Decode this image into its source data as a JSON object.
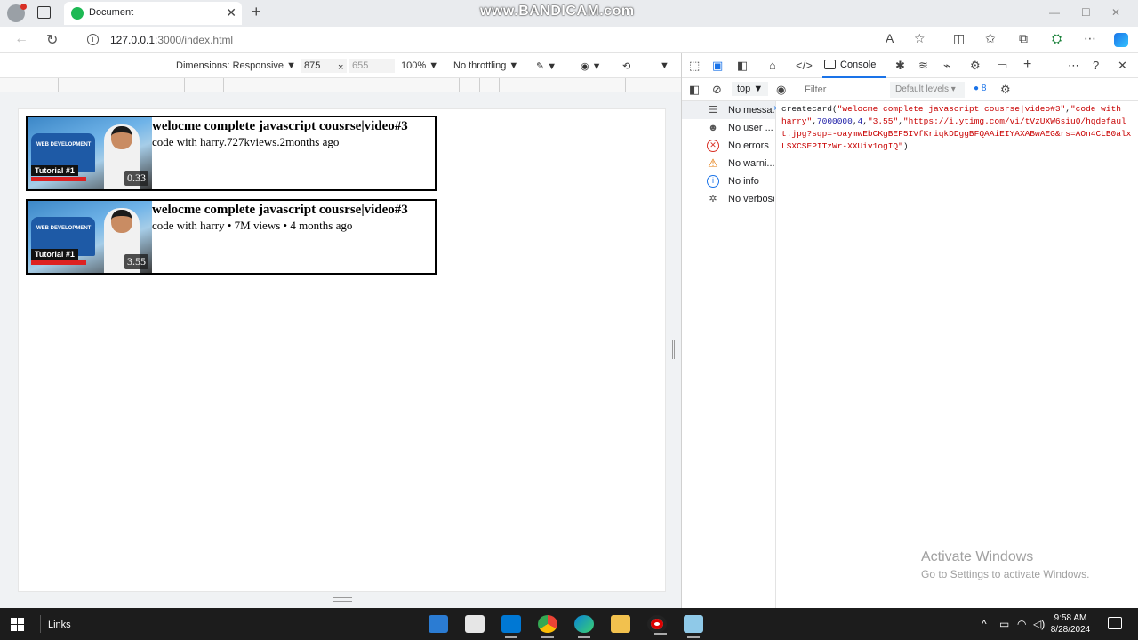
{
  "watermark": "www.BANDICAM.com",
  "browser": {
    "tab_title": "Document",
    "tab_close": "✕",
    "new_tab": "+",
    "url_host": "127.0.0.1",
    "url_rest": ":3000/index.html"
  },
  "device_toolbar": {
    "dimensions": "Dimensions: Responsive",
    "width": "875",
    "times": "×",
    "height": "655",
    "zoom": "100%",
    "throttling": "No throttling"
  },
  "cards": [
    {
      "title": "welocme complete javascript cousrse|video#3",
      "meta": "code with harry.727kviews.2months ago",
      "duration": "0.33",
      "thumb_badge": "Tutorial #1",
      "thumb_text": "WEB DEVELOPMENT"
    },
    {
      "title": "welocme complete javascript cousrse|video#3",
      "meta": "code with harry • 7M views • 4 months ago",
      "duration": "3.55",
      "thumb_badge": "Tutorial #1",
      "thumb_text": "WEB DEVELOPMENT"
    }
  ],
  "devtools": {
    "console_tab": "Console",
    "context": "top",
    "filter_placeholder": "Filter",
    "levels": "Default levels",
    "issues_count": "8",
    "sidebar": [
      {
        "label": "No messa...",
        "icon": "list-icon"
      },
      {
        "label": "No user ...",
        "icon": "user-icon"
      },
      {
        "label": "No errors",
        "icon": "error-icon"
      },
      {
        "label": "No warni...",
        "icon": "warning-icon"
      },
      {
        "label": "No info",
        "icon": "info-icon"
      },
      {
        "label": "No verbose",
        "icon": "verbose-icon"
      }
    ],
    "console": {
      "fn": "createcard(",
      "arg1": "\"welocme complete javascript cousrse|video#3\"",
      "arg2": "\"code with harry\"",
      "arg3": "7000000",
      "arg4": "4",
      "arg5": "\"3.55\"",
      "arg6": "\"https://i.ytimg.com/vi/tVzUXW6siu0/hqdefault.jpg?sqp=-oaymwEbCKgBEF5IVfKriqkDDggBFQAAiEIYAXABwAEG&rs=AOn4CLB0alxLSXCSEPITzWr-XXUiv1ogIQ\"",
      "close": ")"
    }
  },
  "activate_windows": {
    "line1": "Activate Windows",
    "line2": "Go to Settings to activate Windows."
  },
  "taskbar": {
    "links": "Links",
    "time": "9:58 AM",
    "date": "8/28/2024"
  }
}
